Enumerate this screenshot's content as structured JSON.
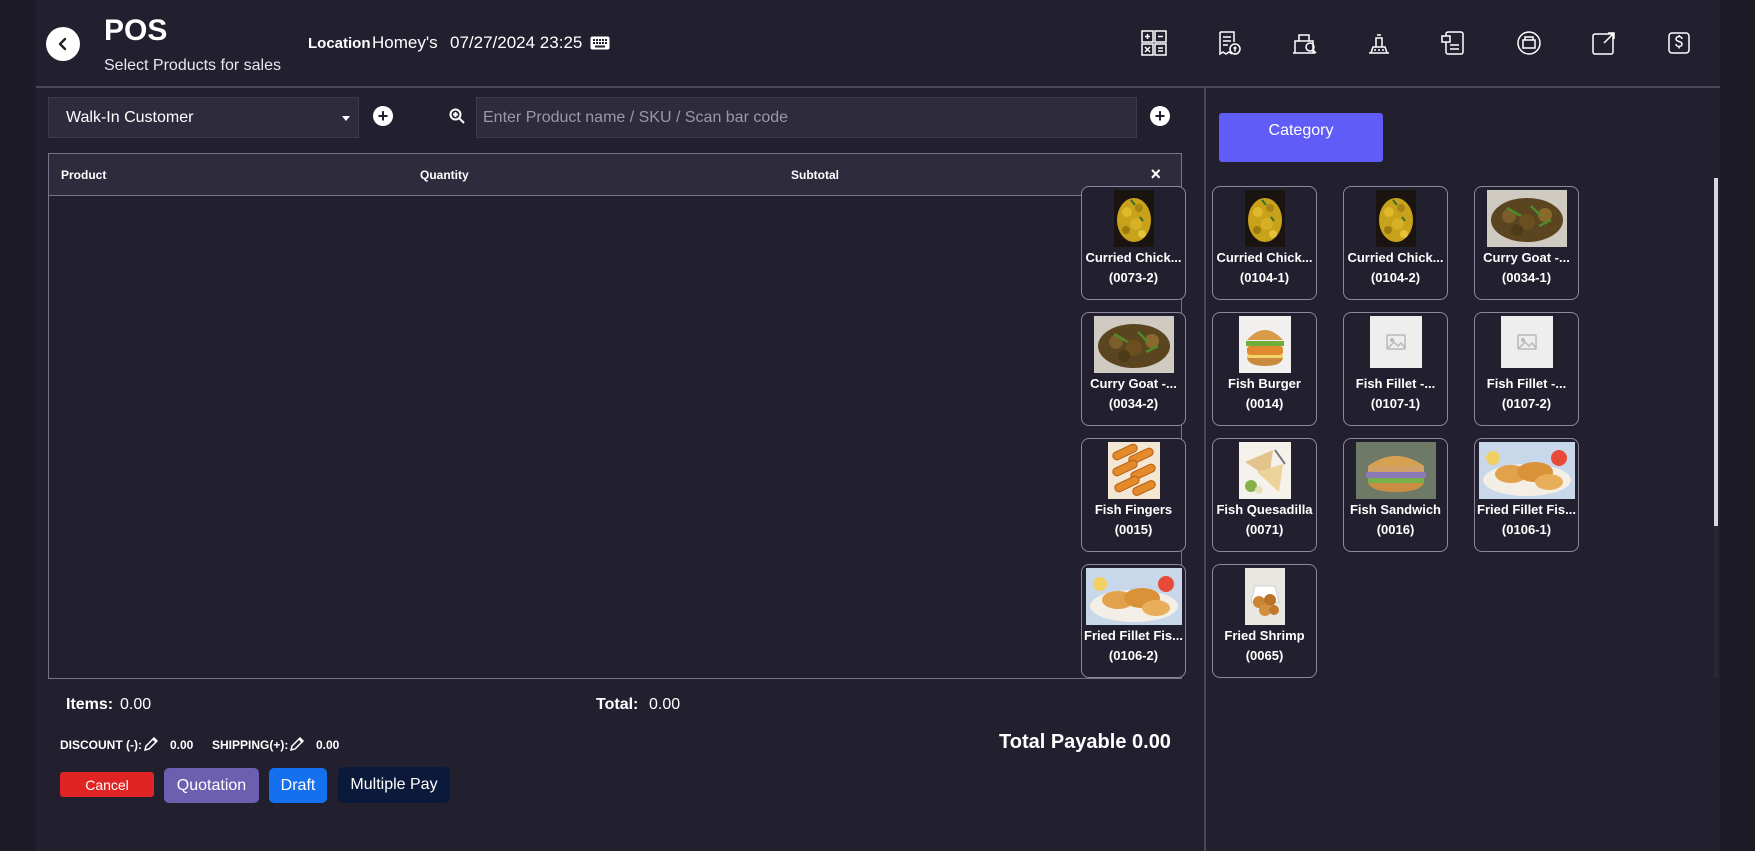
{
  "header": {
    "title": "POS",
    "subtitle": "Select Products for sales",
    "location_label": "Location",
    "location_value": "Homey's",
    "datetime": "07/27/2024 23:25"
  },
  "toolbar_icons": [
    "calculator-icon",
    "receipt-icon",
    "register-details-icon",
    "recent-transactions-icon",
    "suspended-sales-icon",
    "cash-register-icon",
    "fullscreen-icon",
    "expense-icon"
  ],
  "customer": {
    "selected": "Walk-In Customer"
  },
  "search": {
    "placeholder": "Enter Product name / SKU / Scan bar code"
  },
  "cart": {
    "columns": {
      "product": "Product",
      "quantity": "Quantity",
      "subtotal": "Subtotal"
    },
    "rows": []
  },
  "totals": {
    "items_label": "Items:",
    "items_value": "0.00",
    "total_label": "Total:",
    "total_value": "0.00",
    "discount_label": "DISCOUNT (-):",
    "discount_value": "0.00",
    "shipping_label": "SHIPPING(+):",
    "shipping_value": "0.00",
    "total_payable": "Total Payable 0.00"
  },
  "actions": {
    "cancel": "Cancel",
    "quotation": "Quotation",
    "draft": "Draft",
    "multiple_pay": "Multiple Pay"
  },
  "category_label": "Category",
  "products": [
    {
      "name": "Curried Chick...",
      "code": "(0073-2)",
      "image": "curry-chicken"
    },
    {
      "name": "Curried Chick...",
      "code": "(0104-1)",
      "image": "curry-chicken"
    },
    {
      "name": "Curried Chick...",
      "code": "(0104-2)",
      "image": "curry-chicken"
    },
    {
      "name": "Curry Goat -...",
      "code": "(0034-1)",
      "image": "curry-goat"
    },
    {
      "name": "Curry Goat -...",
      "code": "(0034-2)",
      "image": "curry-goat"
    },
    {
      "name": "Fish Burger",
      "code": "(0014)",
      "image": "burger"
    },
    {
      "name": "Fish Fillet -...",
      "code": "(0107-1)",
      "image": "placeholder"
    },
    {
      "name": "Fish Fillet -...",
      "code": "(0107-2)",
      "image": "placeholder"
    },
    {
      "name": "Fish Fingers",
      "code": "(0015)",
      "image": "fingers"
    },
    {
      "name": "Fish Quesadilla",
      "code": "(0071)",
      "image": "quesadilla"
    },
    {
      "name": "Fish Sandwich",
      "code": "(0016)",
      "image": "sandwich"
    },
    {
      "name": "Fried Fillet Fis...",
      "code": "(0106-1)",
      "image": "fried-fillet"
    },
    {
      "name": "Fried Fillet Fis...",
      "code": "(0106-2)",
      "image": "fried-fillet"
    },
    {
      "name": "Fried Shrimp",
      "code": "(0065)",
      "image": "shrimp"
    }
  ],
  "colors": {
    "accent": "#5f5cf7",
    "cancel": "#e02424",
    "quotation": "#6c5fb0",
    "draft": "#1570ef",
    "multiple_pay": "#0b1a3a"
  }
}
